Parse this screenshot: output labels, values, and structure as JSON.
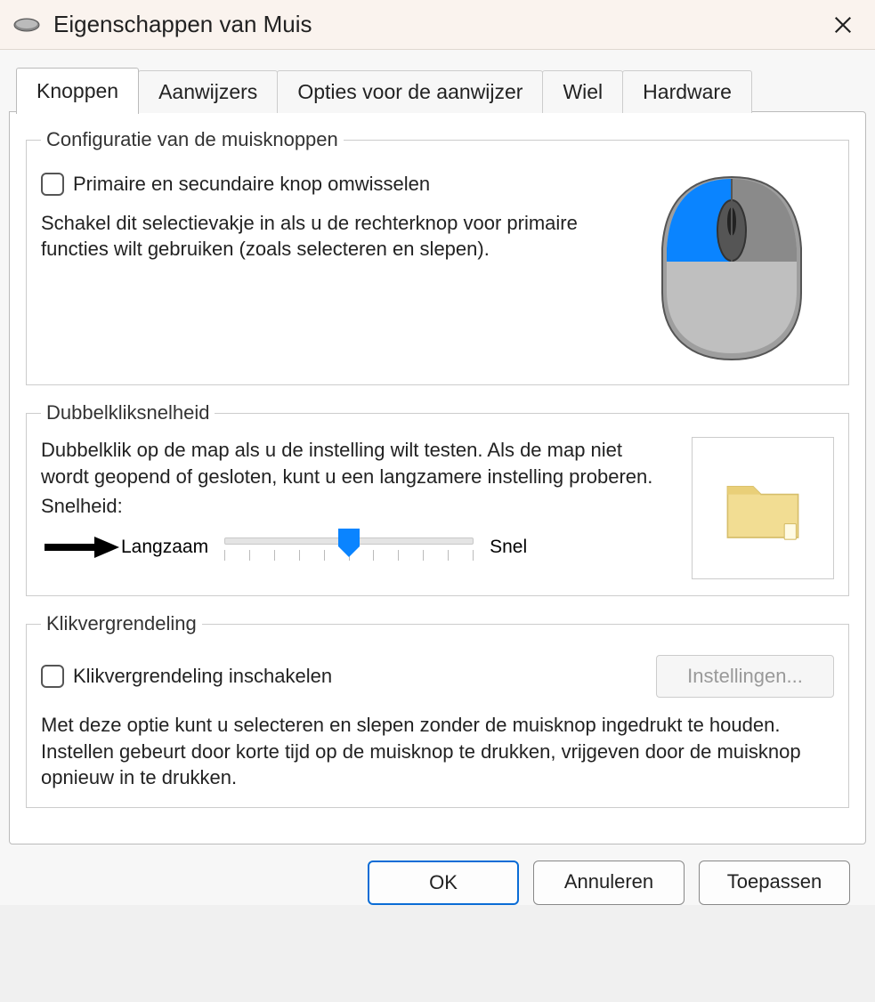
{
  "window": {
    "title": "Eigenschappen van Muis"
  },
  "tabs": [
    {
      "label": "Knoppen",
      "active": true
    },
    {
      "label": "Aanwijzers",
      "active": false
    },
    {
      "label": "Opties voor de aanwijzer",
      "active": false
    },
    {
      "label": "Wiel",
      "active": false
    },
    {
      "label": "Hardware",
      "active": false
    }
  ],
  "group_config": {
    "legend": "Configuratie van de muisknoppen",
    "checkbox_label": "Primaire en secundaire knop omwisselen",
    "checkbox_checked": false,
    "description": "Schakel dit selectievakje in als u de rechterknop voor primaire functies wilt gebruiken (zoals selecteren en slepen)."
  },
  "group_doubleclick": {
    "legend": "Dubbelkliksnelheid",
    "description": "Dubbelklik op de map als u de instelling wilt testen. Als de map niet wordt geopend of gesloten, kunt u een langzamere instelling proberen.",
    "speed_label": "Snelheid:",
    "slow_label": "Langzaam",
    "fast_label": "Snel",
    "slider_min": 0,
    "slider_max": 10,
    "slider_value": 5
  },
  "group_clicklock": {
    "legend": "Klikvergrendeling",
    "checkbox_label": "Klikvergrendeling inschakelen",
    "checkbox_checked": false,
    "settings_button": "Instellingen...",
    "settings_enabled": false,
    "description": "Met deze optie kunt u selecteren en slepen zonder de muisknop ingedrukt te houden. Instellen gebeurt door korte tijd op de muisknop te drukken, vrijgeven door de muisknop opnieuw in te drukken."
  },
  "footer": {
    "ok": "OK",
    "cancel": "Annuleren",
    "apply": "Toepassen"
  },
  "colors": {
    "accent": "#0a84ff",
    "slider_thumb": "#0a84ff"
  }
}
